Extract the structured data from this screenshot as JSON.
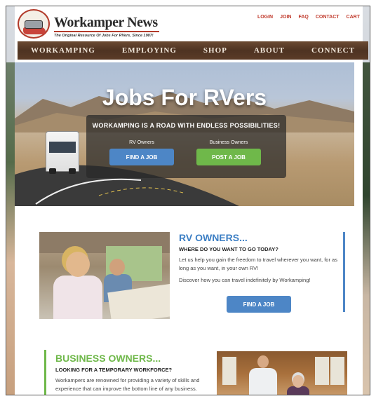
{
  "header": {
    "logo_word1": "Workamper",
    "logo_word2": "News",
    "tagline": "The Original Resource Of Jobs For RVers, Since 1987!",
    "top_links": [
      "LOGIN",
      "JOIN",
      "FAQ",
      "CONTACT",
      "CART"
    ]
  },
  "nav": {
    "items": [
      "WORKAMPING",
      "EMPLOYING",
      "SHOP",
      "ABOUT",
      "CONNECT"
    ]
  },
  "hero": {
    "title": "Jobs For RVers",
    "tagline": "WORKAMPING IS A ROAD WITH ENDLESS POSSIBILITIES!",
    "left_label": "RV Owners",
    "left_button": "FIND A JOB",
    "right_label": "Business Owners",
    "right_button": "POST A JOB"
  },
  "rv_section": {
    "title": "RV OWNERS...",
    "subhead": "WHERE DO YOU WANT TO GO TODAY?",
    "para1": "Let us help you gain the freedom to travel wherever you want, for as long as you want, in your own RV!",
    "para2": "Discover how you can travel indefinitely by Workamping!",
    "button": "FIND A JOB"
  },
  "biz_section": {
    "title": "BUSINESS OWNERS...",
    "subhead": "LOOKING FOR A TEMPORARY WORKFORCE?",
    "para1": "Workampers are renowned for providing a variety of skills and experience that can improve the bottom line of any business."
  },
  "colors": {
    "accent_red": "#c0392b",
    "nav_brown": "#4e3322",
    "blue": "#4d86c6",
    "green": "#6fb84a"
  }
}
